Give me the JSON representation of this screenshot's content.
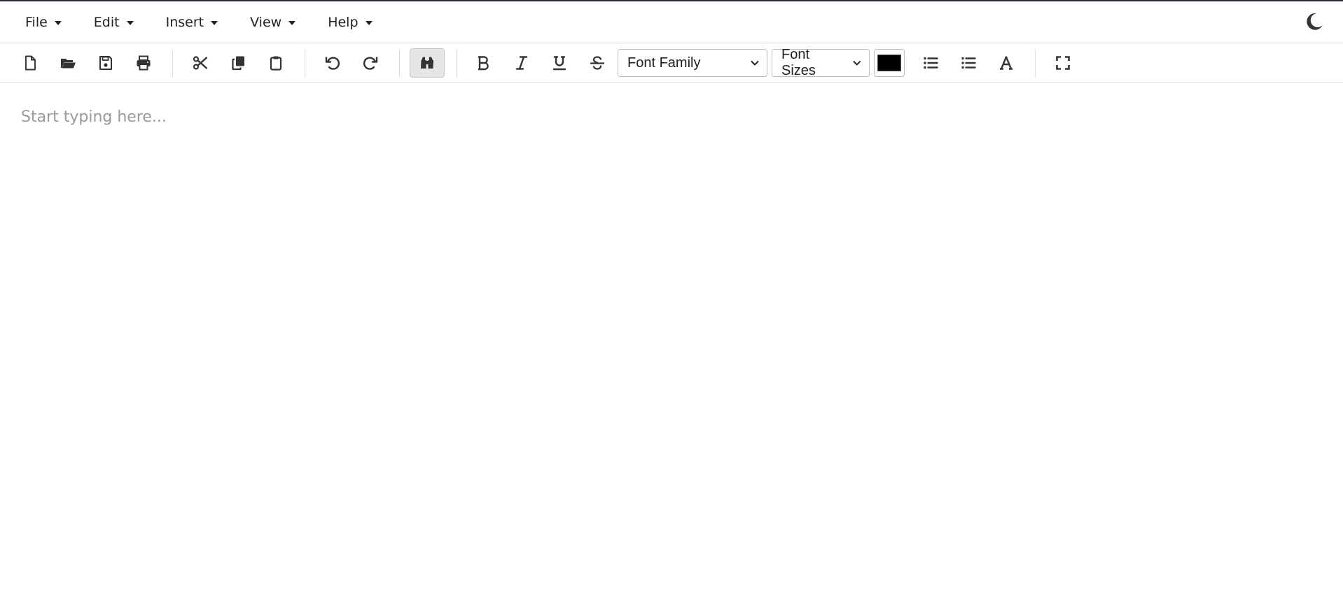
{
  "menu": [
    {
      "label": "File"
    },
    {
      "label": "Edit"
    },
    {
      "label": "Insert"
    },
    {
      "label": "View"
    },
    {
      "label": "Help"
    }
  ],
  "theme_toggle_icon": "moon-icon",
  "toolbar": {
    "font_family": "Font Family",
    "font_size": "Font Sizes",
    "text_color": "#000000",
    "find_active": true
  },
  "editor": {
    "placeholder": "Start typing here..."
  },
  "colors": {
    "icon": "#333333",
    "top_border": "#2b2b3a",
    "placeholder": "#9a9a9a"
  }
}
